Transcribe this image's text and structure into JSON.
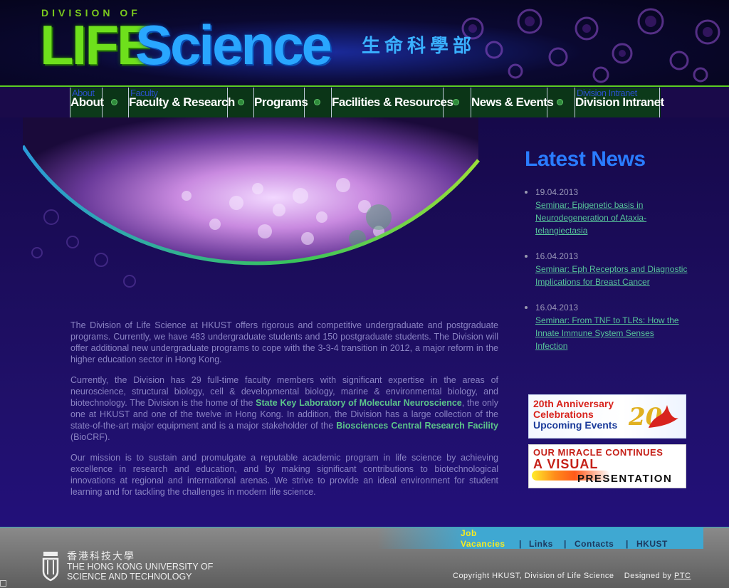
{
  "header": {
    "brand_small": "DIVISION OF",
    "brand_life": "LIFE",
    "brand_science": "Science",
    "brand_chinese": "生命科學部"
  },
  "nav": {
    "items": [
      {
        "label": "About",
        "ghost": "About"
      },
      {
        "label": "Faculty & Research",
        "ghost": "Faculty"
      },
      {
        "label": "Programs"
      },
      {
        "label": "Facilities & Resources"
      },
      {
        "label": "News & Events"
      },
      {
        "label": "Division Intranet",
        "ghost": "Division Intranet"
      }
    ]
  },
  "news": {
    "title": "Latest News",
    "items": [
      {
        "date": "19.04.2013",
        "link": "Seminar: Epigenetic basis in Neurodegeneration of Ataxia-telangiectasia"
      },
      {
        "date": "16.04.2013",
        "link": "Seminar: Eph Receptors and Diagnostic Implications for Breast Cancer"
      },
      {
        "date": "16.04.2013",
        "link": "Seminar: From TNF to TLRs: How the Innate Immune System Senses Infection"
      }
    ]
  },
  "banners": {
    "anniversary": {
      "line1": "20th Anniversary",
      "line2": "Celebrations",
      "line3": "Upcoming Events"
    },
    "miracle": {
      "line1": "OUR MIRACLE CONTINUES",
      "line2": "A VISUAL",
      "line3": "PRESENTATION"
    }
  },
  "body": {
    "p1": "The Division of Life Science at HKUST offers rigorous and competitive undergraduate and postgraduate programs. Currently, we have 483 undergraduate students and 150 postgraduate students. The Division will offer additional new undergraduate programs to cope with the 3-3-4 transition in 2012, a major reform in the higher education sector in Hong Kong.",
    "p2_a": "Currently, the Division has 29 full-time faculty members with significant expertise in the areas of neuroscience, structural biology, cell & developmental biology, marine & environmental biology, and biotechnology. The Division is the home of the ",
    "p2_link1": "State Key Laboratory of Molecular Neuroscience",
    "p2_b": ", the only one at HKUST and one of the twelve in Hong Kong. In addition, the Division has a large collection of the state-of-the-art major equipment and is a major stakeholder of the ",
    "p2_link2": "Biosciences Central Research Facility",
    "p2_c": " (BioCRF).",
    "p3": "Our mission is to sustain and promulgate a reputable academic program in life science by achieving excellence in research and education, and by making significant contributions to biotechnological innovations at regional and international arenas. We strive to provide an ideal environment for student learning and for tackling the challenges in modern life science."
  },
  "footer": {
    "links": {
      "job_line1": "Job",
      "job_line2": "Vacancies",
      "links": "Links",
      "contacts": "Contacts",
      "hkust": "HKUST",
      "sep": "|"
    },
    "hkust_cn": "香港科技大學",
    "hkust_en1": "THE HONG KONG UNIVERSITY OF",
    "hkust_en2": "SCIENCE AND TECHNOLOGY",
    "copyright": "Copyright HKUST, Division of Life Science",
    "designed_by": "Designed by",
    "designer": "PTC"
  },
  "colors": {
    "accent_green": "#6ee01c",
    "accent_blue": "#29a6ff",
    "news_link": "#57c49a",
    "body_text": "#8b84c4"
  }
}
